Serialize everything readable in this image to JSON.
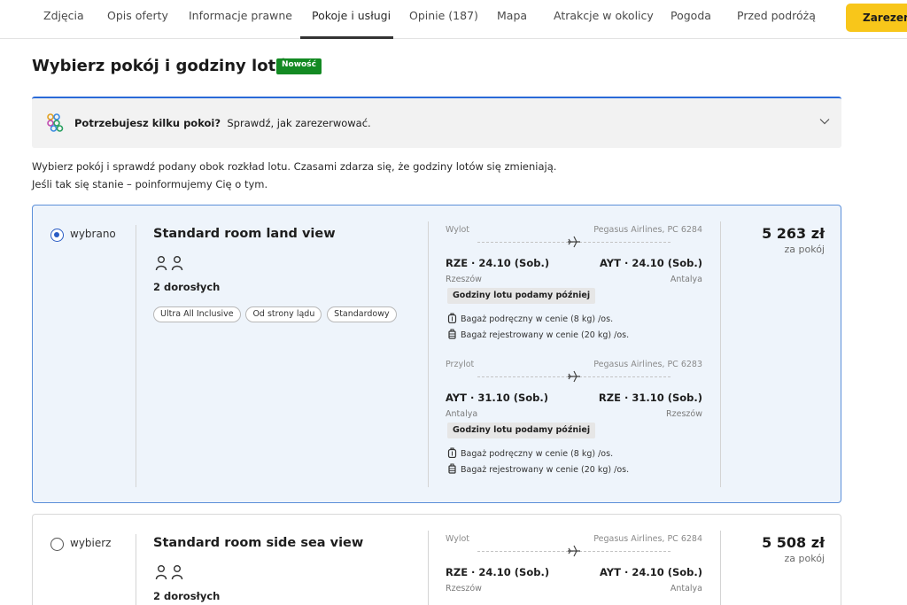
{
  "nav": {
    "tabs": [
      {
        "label": "Zdjęcia"
      },
      {
        "label": "Opis oferty"
      },
      {
        "label": "Informacje prawne"
      },
      {
        "label": "Pokoje i usługi"
      },
      {
        "label": "Opinie (187)"
      },
      {
        "label": "Mapa"
      },
      {
        "label": "Atrakcje w okolicy"
      },
      {
        "label": "Pogoda"
      },
      {
        "label": "Przed podróżą"
      }
    ],
    "active_tab": "Pokoje i usługi",
    "reserve_label": "Zarezerwuj"
  },
  "section": {
    "title": "Wybierz pokój i godziny lotów",
    "badge": "Nowość"
  },
  "banner": {
    "bold": "Potrzebujesz kilku pokoi?",
    "text": "Sprawdź, jak zarezerwować."
  },
  "intro": {
    "line1": "Wybierz pokój i sprawdź podany obok rozkład lotu. Czasami zdarza się, że godziny lotów się zmieniają.",
    "line2": "Jeśli tak się stanie – poinformujemy Cię o tym."
  },
  "rooms": [
    {
      "radio_label": "wybrano",
      "selected": true,
      "name": "Standard room land view",
      "adults": "2 dorosłych",
      "tags": [
        "Ultra All Inclusive",
        "Od strony lądu",
        "Standardowy"
      ],
      "price": "5 263 zł",
      "price_sub": "za pokój",
      "outbound": {
        "label": "Wylot",
        "airline": "Pegasus Airlines, PC 6284",
        "from": "RZE · 24.10 (Sob.)",
        "to": "AYT · 24.10 (Sob.)",
        "from_city": "Rzeszów",
        "to_city": "Antalya",
        "note": "Godziny lotu podamy później",
        "bag_hand": "Bagaż podręczny w cenie (8 kg) /os.",
        "bag_checked": "Bagaż rejestrowany w cenie (20 kg) /os."
      },
      "inbound": {
        "label": "Przylot",
        "airline": "Pegasus Airlines, PC 6283",
        "from": "AYT · 31.10 (Sob.)",
        "to": "RZE · 31.10 (Sob.)",
        "from_city": "Antalya",
        "to_city": "Rzeszów",
        "note": "Godziny lotu podamy później",
        "bag_hand": "Bagaż podręczny w cenie (8 kg) /os.",
        "bag_checked": "Bagaż rejestrowany w cenie (20 kg) /os."
      }
    },
    {
      "radio_label": "wybierz",
      "selected": false,
      "name": "Standard room side sea view",
      "adults": "2 dorosłych",
      "price": "5 508 zł",
      "price_sub": "za pokój",
      "outbound": {
        "label": "Wylot",
        "airline": "Pegasus Airlines, PC 6284",
        "from": "RZE · 24.10 (Sob.)",
        "to": "AYT · 24.10 (Sob.)",
        "from_city": "Rzeszów",
        "to_city": "Antalya"
      }
    }
  ],
  "colors": {
    "accent_blue": "#2a5cc4",
    "selected_bg": "#eef4fb",
    "badge_green": "#138a23",
    "reserve_yellow": "#f8c61a"
  },
  "icons": [
    "group-rooms-icon",
    "chevron-down-icon",
    "person-icon",
    "plane-icon",
    "hand-luggage-icon",
    "checked-luggage-icon"
  ]
}
